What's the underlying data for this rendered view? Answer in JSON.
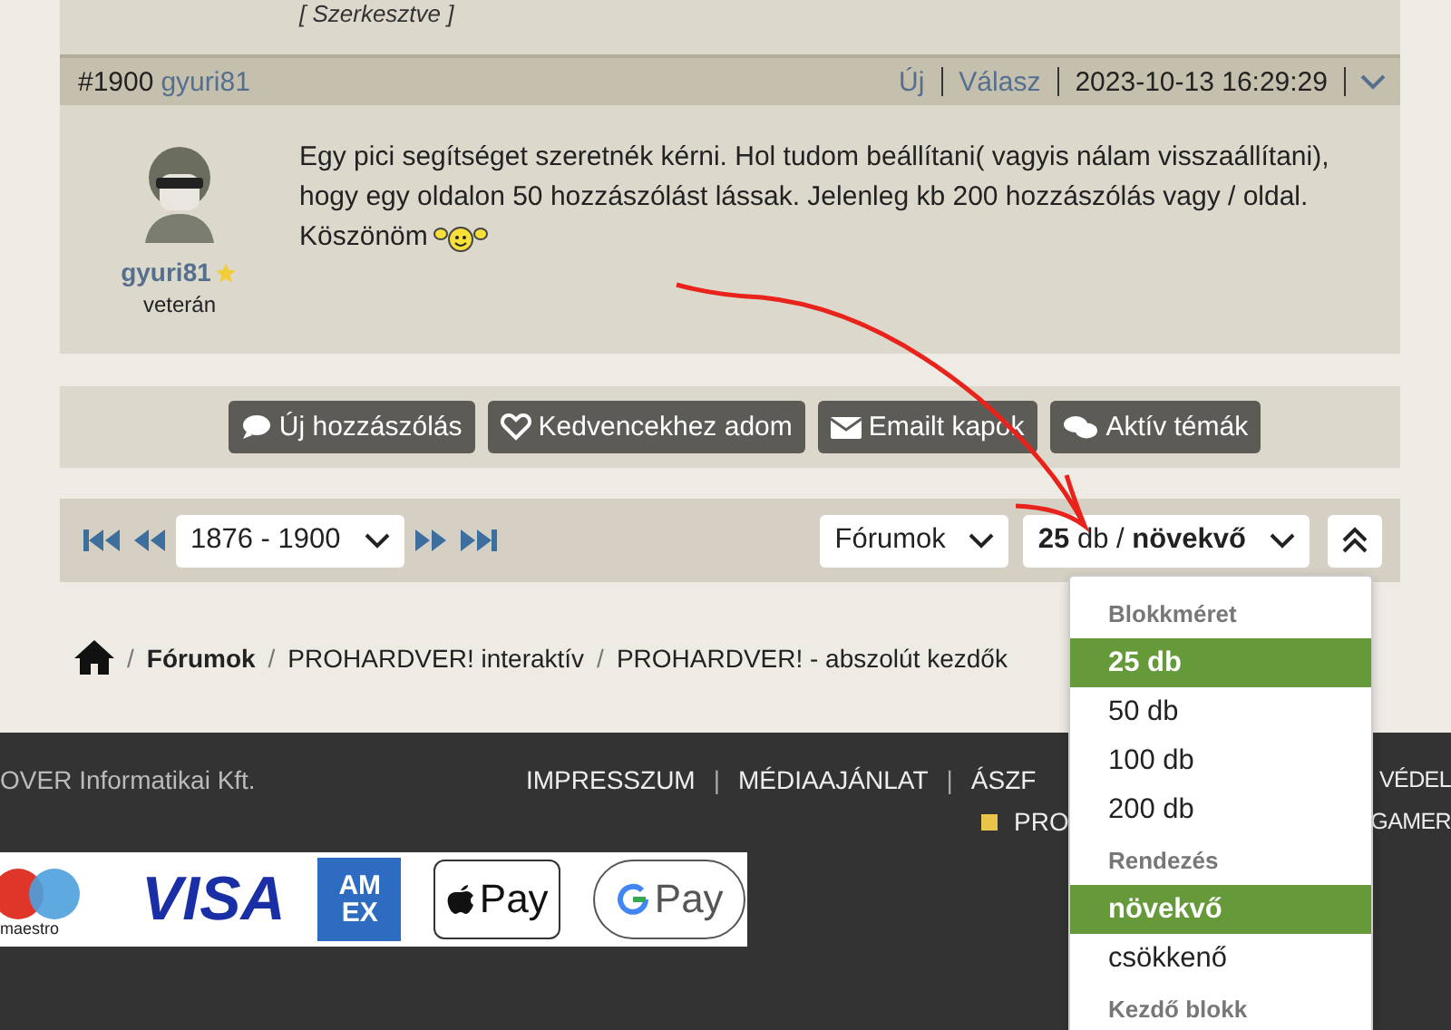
{
  "previous_post": {
    "edited_note": "[ Szerkesztve ]"
  },
  "post": {
    "number": "#1900",
    "author": "gyuri81",
    "new_link": "Új",
    "reply_link": "Válasz",
    "timestamp": "2023-10-13 16:29:29",
    "user_name": "gyuri81",
    "user_rank": "veterán",
    "text_lines": [
      "Egy pici segítséget szeretnék kérni. Hol tudom beállítani( vagyis nálam visszaállítani),",
      "hogy egy oldalon 50 hozzászólást lássak. Jelenleg kb 200 hozzászólás vagy / oldal.",
      "Köszönöm"
    ]
  },
  "actions": [
    {
      "kind": "comment",
      "label": "Új hozzászólás"
    },
    {
      "kind": "heart",
      "label": "Kedvencekhez adom"
    },
    {
      "kind": "mail",
      "label": "Emailt kapok"
    },
    {
      "kind": "chats",
      "label": "Aktív témák"
    }
  ],
  "pager": {
    "range": "1876 - 1900",
    "forums": "Fórumok",
    "block_setting": "**25** db / **növekvő**"
  },
  "breadcrumb": [
    {
      "separator": "/",
      "label": "Fórumok"
    },
    {
      "separator": "/",
      "label": "PROHARDVER! interaktív"
    },
    {
      "separator": "/",
      "label": "PROHARDVER! - abszolút kezdők"
    }
  ],
  "dropdown": [
    {
      "kind": "header",
      "label": "Blokkméret"
    },
    {
      "kind": "option",
      "label": "25 db",
      "selected": true
    },
    {
      "kind": "option",
      "label": "50 db",
      "selected": false
    },
    {
      "kind": "option",
      "label": "100 db",
      "selected": false
    },
    {
      "kind": "option",
      "label": "200 db",
      "selected": false
    },
    {
      "kind": "header",
      "label": "Rendezés"
    },
    {
      "kind": "option",
      "label": "növekvő",
      "selected": true
    },
    {
      "kind": "option",
      "label": "csökkenő",
      "selected": false
    },
    {
      "kind": "header",
      "label": "Kezdő blokk"
    }
  ],
  "footer": {
    "company": "OVER Informatikai Kft.",
    "links": [
      {
        "label": "IMPRESSZUM"
      },
      {
        "separator": "|",
        "label": "MÉDIAAJÁNLAT"
      },
      {
        "separator": "|",
        "label": "ÁSZF"
      }
    ],
    "links_right": "VÉDEL",
    "sites": "PRO",
    "sites_right": "GAMER",
    "payments": [
      {
        "kind": "maestro",
        "label": "maestro"
      },
      {
        "kind": "visa",
        "label": "VISA"
      },
      {
        "kind": "amex",
        "label": "AM EX"
      },
      {
        "kind": "applepay",
        "label": "Pay"
      },
      {
        "kind": "googlepay",
        "label": "Pay"
      }
    ]
  }
}
